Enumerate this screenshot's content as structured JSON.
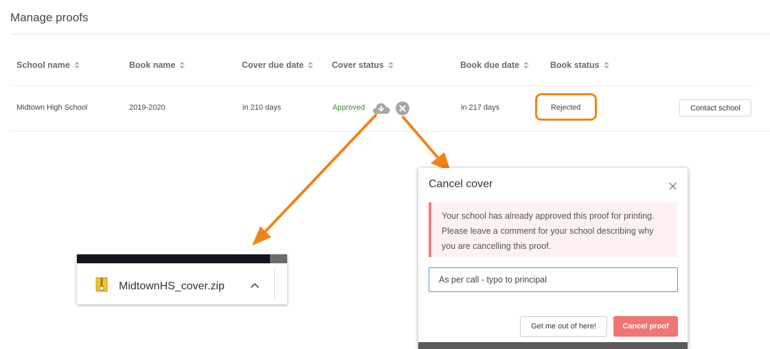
{
  "page": {
    "title": "Manage proofs"
  },
  "table": {
    "columns": [
      "School name",
      "Book name",
      "Cover due date",
      "Cover status",
      "Book due date",
      "Book status"
    ],
    "row": {
      "school_name": "Midtown High School",
      "book_name": "2019-2020",
      "cover_due": "in 210 days",
      "cover_status": "Approved",
      "book_due": "in 217 days",
      "book_status": "Rejected",
      "action_label": "Contact school"
    }
  },
  "icons": {
    "download": "cloud-download-icon",
    "cancel": "close-circle-icon"
  },
  "download_bar": {
    "file_name": "MidtownHS_cover.zip"
  },
  "modal": {
    "title": "Cancel cover",
    "alert": "Your school has already approved this proof for printing. Please leave a comment for your school describing why you are cancelling this proof.",
    "comment_value": "As per call - typo to principal",
    "secondary_label": "Get me out of here!",
    "primary_label": "Cancel proof"
  },
  "colors": {
    "annotation": "#f08416",
    "approved": "#2e8b2e",
    "danger": "#f07575",
    "input_focus": "#3aa0c9"
  }
}
